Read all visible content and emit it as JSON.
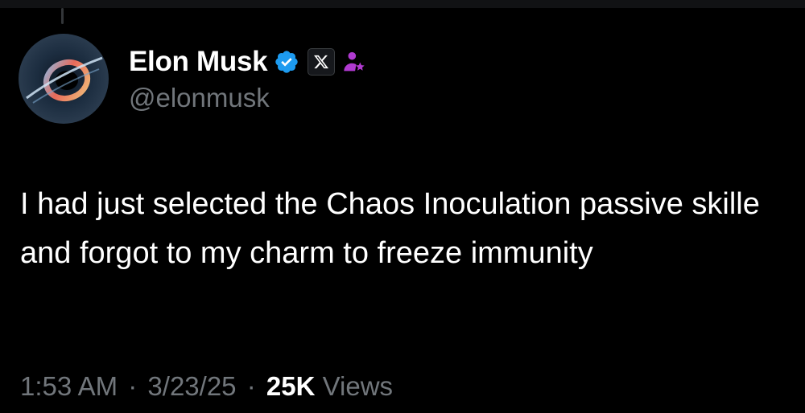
{
  "author": {
    "display_name": "Elon Musk",
    "handle": "@elonmusk",
    "avatar_icon": "black-hole-avatar",
    "verified_icon": "verified-badge-icon",
    "org_icon": "x-logo-icon",
    "affiliate_icon": "affiliate-person-star-icon"
  },
  "tweet": {
    "text": "I had just selected the Chaos Inoculation passive skille and forgot to my charm to freeze immunity"
  },
  "meta": {
    "time": "1:53 AM",
    "separator": "·",
    "date": "3/23/25",
    "views_count": "25K",
    "views_label": "Views"
  },
  "colors": {
    "background": "#000000",
    "text_primary": "#ffffff",
    "text_secondary": "#71767b",
    "verified_blue": "#1d9bf0",
    "affiliate_purple": "#b03ad0"
  }
}
